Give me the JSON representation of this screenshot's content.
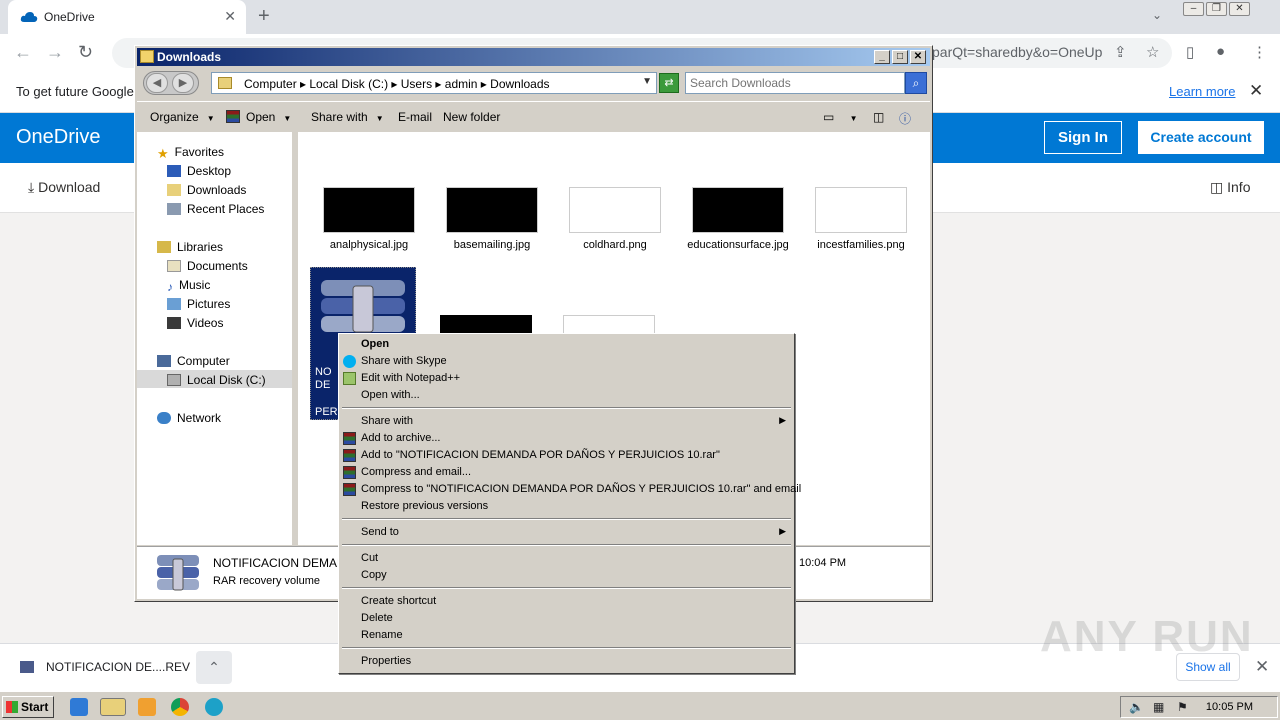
{
  "browser": {
    "tab_title": "OneDrive",
    "url_fragment": "parQt=sharedby&o=OneUp",
    "info_bar": {
      "message": "To get future Google",
      "learn_more": "Learn more"
    }
  },
  "onedrive": {
    "brand": "OneDrive",
    "sign_in": "Sign In",
    "create_account": "Create account",
    "download": "Download",
    "info": "Info",
    "accent": "#0078d4"
  },
  "download_shelf": {
    "file_name": "NOTIFICACION DE....REV",
    "show_all": "Show all"
  },
  "watermark": "ANY RUN",
  "explorer": {
    "title": "Downloads",
    "breadcrumb": "Computer ▸ Local Disk (C:) ▸ Users ▸ admin ▸ Downloads",
    "search_placeholder": "Search Downloads",
    "toolbar": {
      "organize": "Organize",
      "open": "Open",
      "share_with": "Share with",
      "email": "E-mail",
      "new_folder": "New folder"
    },
    "nav": {
      "favorites": "Favorites",
      "desktop": "Desktop",
      "downloads": "Downloads",
      "recent_places": "Recent Places",
      "libraries": "Libraries",
      "documents": "Documents",
      "music": "Music",
      "pictures": "Pictures",
      "videos": "Videos",
      "computer": "Computer",
      "local_disk": "Local Disk (C:)",
      "network": "Network"
    },
    "files": [
      {
        "name": "analphysical.jpg"
      },
      {
        "name": "basemailing.jpg"
      },
      {
        "name": "coldhard.png"
      },
      {
        "name": "educationsurface.jpg"
      },
      {
        "name": "incestfamilies.png"
      }
    ],
    "selected_file": {
      "line1": "NO",
      "line2": "DE",
      "line3": "PER"
    },
    "details": {
      "name": "NOTIFICACION DEMAN",
      "type": "RAR recovery volume",
      "date": "10:04 PM"
    }
  },
  "context_menu": {
    "open": "Open",
    "share_skype": "Share with Skype",
    "edit_notepad": "Edit with Notepad++",
    "open_with": "Open with...",
    "share_with": "Share with",
    "add_archive": "Add to archive...",
    "add_to_rar": "Add to \"NOTIFICACION DEMANDA POR DAÑOS Y PERJUICIOS 10.rar\"",
    "compress_email": "Compress and email...",
    "compress_rar_email": "Compress to \"NOTIFICACION DEMANDA POR DAÑOS Y PERJUICIOS 10.rar\" and email",
    "restore": "Restore previous versions",
    "send_to": "Send to",
    "cut": "Cut",
    "copy": "Copy",
    "create_shortcut": "Create shortcut",
    "delete": "Delete",
    "rename": "Rename",
    "properties": "Properties"
  },
  "taskbar": {
    "start": "Start",
    "clock": "10:05 PM"
  }
}
